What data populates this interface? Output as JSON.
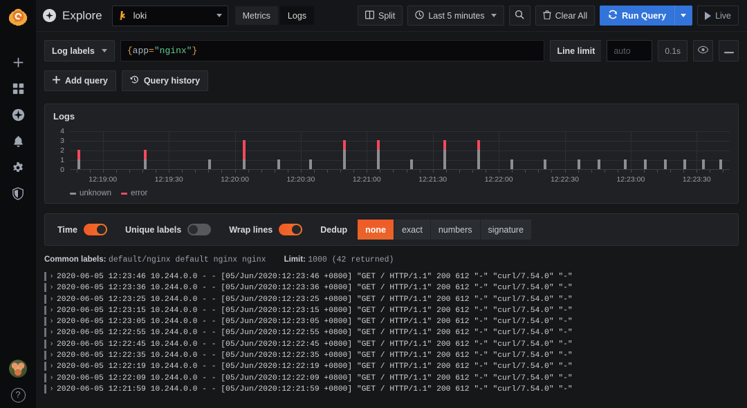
{
  "sidebar": {
    "logo_name": "grafana-logo",
    "items": [
      {
        "name": "create-add",
        "icon": "plus-icon"
      },
      {
        "name": "dashboards",
        "icon": "apps-icon"
      },
      {
        "name": "explore",
        "icon": "compass-icon"
      },
      {
        "name": "alerting",
        "icon": "bell-icon"
      },
      {
        "name": "configuration",
        "icon": "gear-icon"
      },
      {
        "name": "server-admin",
        "icon": "shield-icon"
      }
    ],
    "bottom": [
      {
        "name": "user-avatar",
        "icon": "avatar"
      },
      {
        "name": "help",
        "icon": "question-icon",
        "glyph": "?"
      }
    ]
  },
  "toolbar": {
    "title": "Explore",
    "datasource": "loki",
    "modes": [
      {
        "label": "Metrics",
        "active": false
      },
      {
        "label": "Logs",
        "active": true
      }
    ],
    "split_label": "Split",
    "time_range": "Last 5 minutes",
    "search_icon": "search-icon",
    "clear_all_label": "Clear All",
    "run_query_label": "Run Query",
    "live_label": "Live"
  },
  "query": {
    "log_labels_label": "Log labels",
    "expr_brace_open": "{",
    "expr_key": "app",
    "expr_eq": "=",
    "expr_value": "\"nginx\"",
    "expr_brace_close": "}",
    "line_limit_label": "Line limit",
    "line_limit_placeholder": "auto",
    "line_limit_value": "",
    "timing": "0.1s",
    "eye_icon": "eye-icon",
    "remove_icon": "minus-icon",
    "add_query_label": "Add query",
    "query_history_label": "Query history"
  },
  "panel": {
    "title": "Logs"
  },
  "chart_data": {
    "type": "bar",
    "title": "Logs",
    "xlabel": "",
    "ylabel": "",
    "ylim": [
      0,
      4
    ],
    "yticks": [
      0,
      1,
      2,
      3,
      4
    ],
    "grid": true,
    "legend_position": "bottom-left",
    "stacked": true,
    "x_tick_labels": [
      "12:19:00",
      "12:19:30",
      "12:20:00",
      "12:20:30",
      "12:21:00",
      "12:21:30",
      "12:22:00",
      "12:22:30",
      "12:23:00",
      "12:23:30"
    ],
    "series": [
      {
        "name": "unknown",
        "color": "#8e8e8e"
      },
      {
        "name": "error",
        "color": "#f2495c"
      }
    ],
    "bars": [
      {
        "x_pct": 1.2,
        "unknown": 1,
        "error": 1
      },
      {
        "x_pct": 11.2,
        "unknown": 1,
        "error": 1
      },
      {
        "x_pct": 21.0,
        "unknown": 1,
        "error": 0
      },
      {
        "x_pct": 26.2,
        "unknown": 1,
        "error": 2
      },
      {
        "x_pct": 31.4,
        "unknown": 1,
        "error": 0
      },
      {
        "x_pct": 36.3,
        "unknown": 1,
        "error": 0
      },
      {
        "x_pct": 41.4,
        "unknown": 2,
        "error": 1
      },
      {
        "x_pct": 46.5,
        "unknown": 2,
        "error": 1
      },
      {
        "x_pct": 51.6,
        "unknown": 1,
        "error": 0
      },
      {
        "x_pct": 56.6,
        "unknown": 2,
        "error": 1
      },
      {
        "x_pct": 61.7,
        "unknown": 2,
        "error": 1
      },
      {
        "x_pct": 66.8,
        "unknown": 1,
        "error": 0
      },
      {
        "x_pct": 71.8,
        "unknown": 1,
        "error": 0
      },
      {
        "x_pct": 76.9,
        "unknown": 1,
        "error": 0
      },
      {
        "x_pct": 80.0,
        "unknown": 1,
        "error": 0
      },
      {
        "x_pct": 84.0,
        "unknown": 1,
        "error": 0
      },
      {
        "x_pct": 87.0,
        "unknown": 1,
        "error": 0
      },
      {
        "x_pct": 90.0,
        "unknown": 1,
        "error": 0
      },
      {
        "x_pct": 93.0,
        "unknown": 1,
        "error": 0
      },
      {
        "x_pct": 95.8,
        "unknown": 1,
        "error": 0
      },
      {
        "x_pct": 98.4,
        "unknown": 1,
        "error": 0
      }
    ]
  },
  "controls": {
    "time_label": "Time",
    "time_on": true,
    "unique_labels_label": "Unique labels",
    "unique_labels_on": false,
    "wrap_lines_label": "Wrap lines",
    "wrap_lines_on": true,
    "dedup_label": "Dedup",
    "dedup_options": [
      {
        "label": "none",
        "active": true
      },
      {
        "label": "exact",
        "active": false
      },
      {
        "label": "numbers",
        "active": false
      },
      {
        "label": "signature",
        "active": false
      }
    ]
  },
  "meta": {
    "common_labels_key": "Common labels:",
    "common_labels_values": "default/nginx  default  nginx  nginx",
    "limit_key": "Limit:",
    "limit_value": "1000 (42 returned)"
  },
  "logs": {
    "rows": [
      {
        "text": "2020-06-05 12:23:46 10.244.0.0 - - [05/Jun/2020:12:23:46 +0800] \"GET / HTTP/1.1\" 200 612 \"-\" \"curl/7.54.0\" \"-\""
      },
      {
        "text": "2020-06-05 12:23:36 10.244.0.0 - - [05/Jun/2020:12:23:36 +0800] \"GET / HTTP/1.1\" 200 612 \"-\" \"curl/7.54.0\" \"-\""
      },
      {
        "text": "2020-06-05 12:23:25 10.244.0.0 - - [05/Jun/2020:12:23:25 +0800] \"GET / HTTP/1.1\" 200 612 \"-\" \"curl/7.54.0\" \"-\""
      },
      {
        "text": "2020-06-05 12:23:15 10.244.0.0 - - [05/Jun/2020:12:23:15 +0800] \"GET / HTTP/1.1\" 200 612 \"-\" \"curl/7.54.0\" \"-\""
      },
      {
        "text": "2020-06-05 12:23:05 10.244.0.0 - - [05/Jun/2020:12:23:05 +0800] \"GET / HTTP/1.1\" 200 612 \"-\" \"curl/7.54.0\" \"-\""
      },
      {
        "text": "2020-06-05 12:22:55 10.244.0.0 - - [05/Jun/2020:12:22:55 +0800] \"GET / HTTP/1.1\" 200 612 \"-\" \"curl/7.54.0\" \"-\""
      },
      {
        "text": "2020-06-05 12:22:45 10.244.0.0 - - [05/Jun/2020:12:22:45 +0800] \"GET / HTTP/1.1\" 200 612 \"-\" \"curl/7.54.0\" \"-\""
      },
      {
        "text": "2020-06-05 12:22:35 10.244.0.0 - - [05/Jun/2020:12:22:35 +0800] \"GET / HTTP/1.1\" 200 612 \"-\" \"curl/7.54.0\" \"-\""
      },
      {
        "text": "2020-06-05 12:22:19 10.244.0.0 - - [05/Jun/2020:12:22:19 +0800] \"GET / HTTP/1.1\" 200 612 \"-\" \"curl/7.54.0\" \"-\""
      },
      {
        "text": "2020-06-05 12:22:09 10.244.0.0 - - [05/Jun/2020:12:22:09 +0800] \"GET / HTTP/1.1\" 200 612 \"-\" \"curl/7.54.0\" \"-\""
      },
      {
        "text": "2020-06-05 12:21:59 10.244.0.0 - - [05/Jun/2020:12:21:59 +0800] \"GET / HTTP/1.1\" 200 612 \"-\" \"curl/7.54.0\" \"-\""
      }
    ],
    "expand_glyph": "›"
  },
  "colors": {
    "accent_orange": "#f05a28",
    "primary_blue": "#3274d9",
    "error_red": "#f2495c",
    "unknown_gray": "#8e8e8e"
  }
}
